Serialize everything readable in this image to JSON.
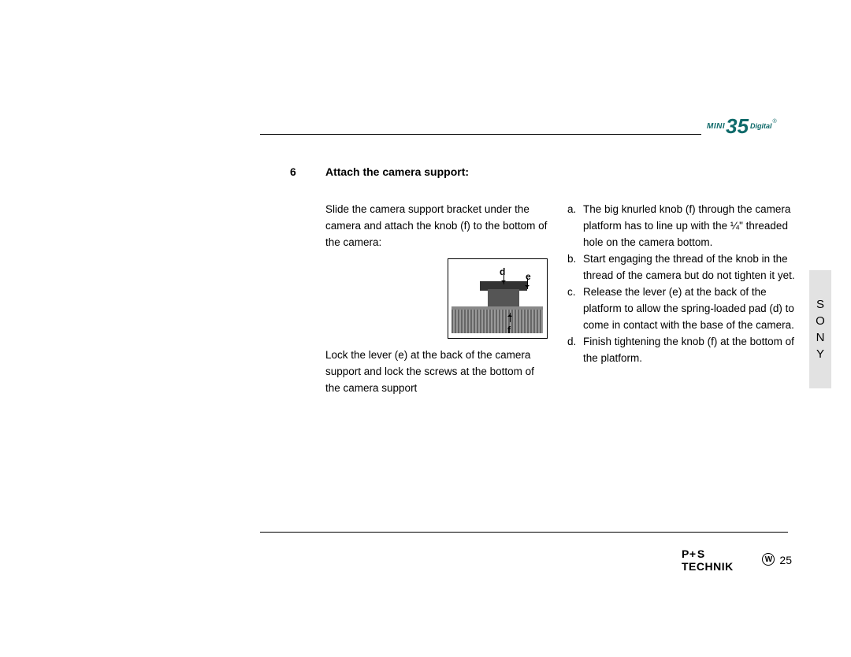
{
  "header_logo": {
    "mini": "MINI",
    "num": "35",
    "digital": "Digital",
    "reg": "®"
  },
  "side_tab": [
    "S",
    "O",
    "N",
    "Y"
  ],
  "step": {
    "number": "6",
    "title": "Attach the camera support:",
    "left_para1": "Slide the camera support bracket under the camera and attach the knob (f) to the bottom of the camera:",
    "left_para2": "Lock the lever (e) at the back of the camera support and lock the screws at the bottom of the camera support",
    "figure_labels": {
      "d": "d",
      "e": "e",
      "f": "f"
    },
    "right_items": [
      {
        "marker": "a.",
        "text": "The big knurled knob (f) through the camera platform has to line up with the ¼\" threaded hole on the camera bottom."
      },
      {
        "marker": "b.",
        "text": "Start engaging the thread of the knob in the thread of the camera but do not tighten it yet."
      },
      {
        "marker": "c.",
        "text": "Release the lever (e) at the back of the platform to allow the spring-loaded pad (d) to come in contact with the base of the camera."
      },
      {
        "marker": "d.",
        "text": "Finish tightening the knob (f) at the bottom of the platform."
      }
    ]
  },
  "footer": {
    "brand_p": "P",
    "brand_plus": "+",
    "brand_s": "S",
    "brand_technik": " TECHNIK",
    "wmark": "W",
    "page": "25"
  }
}
